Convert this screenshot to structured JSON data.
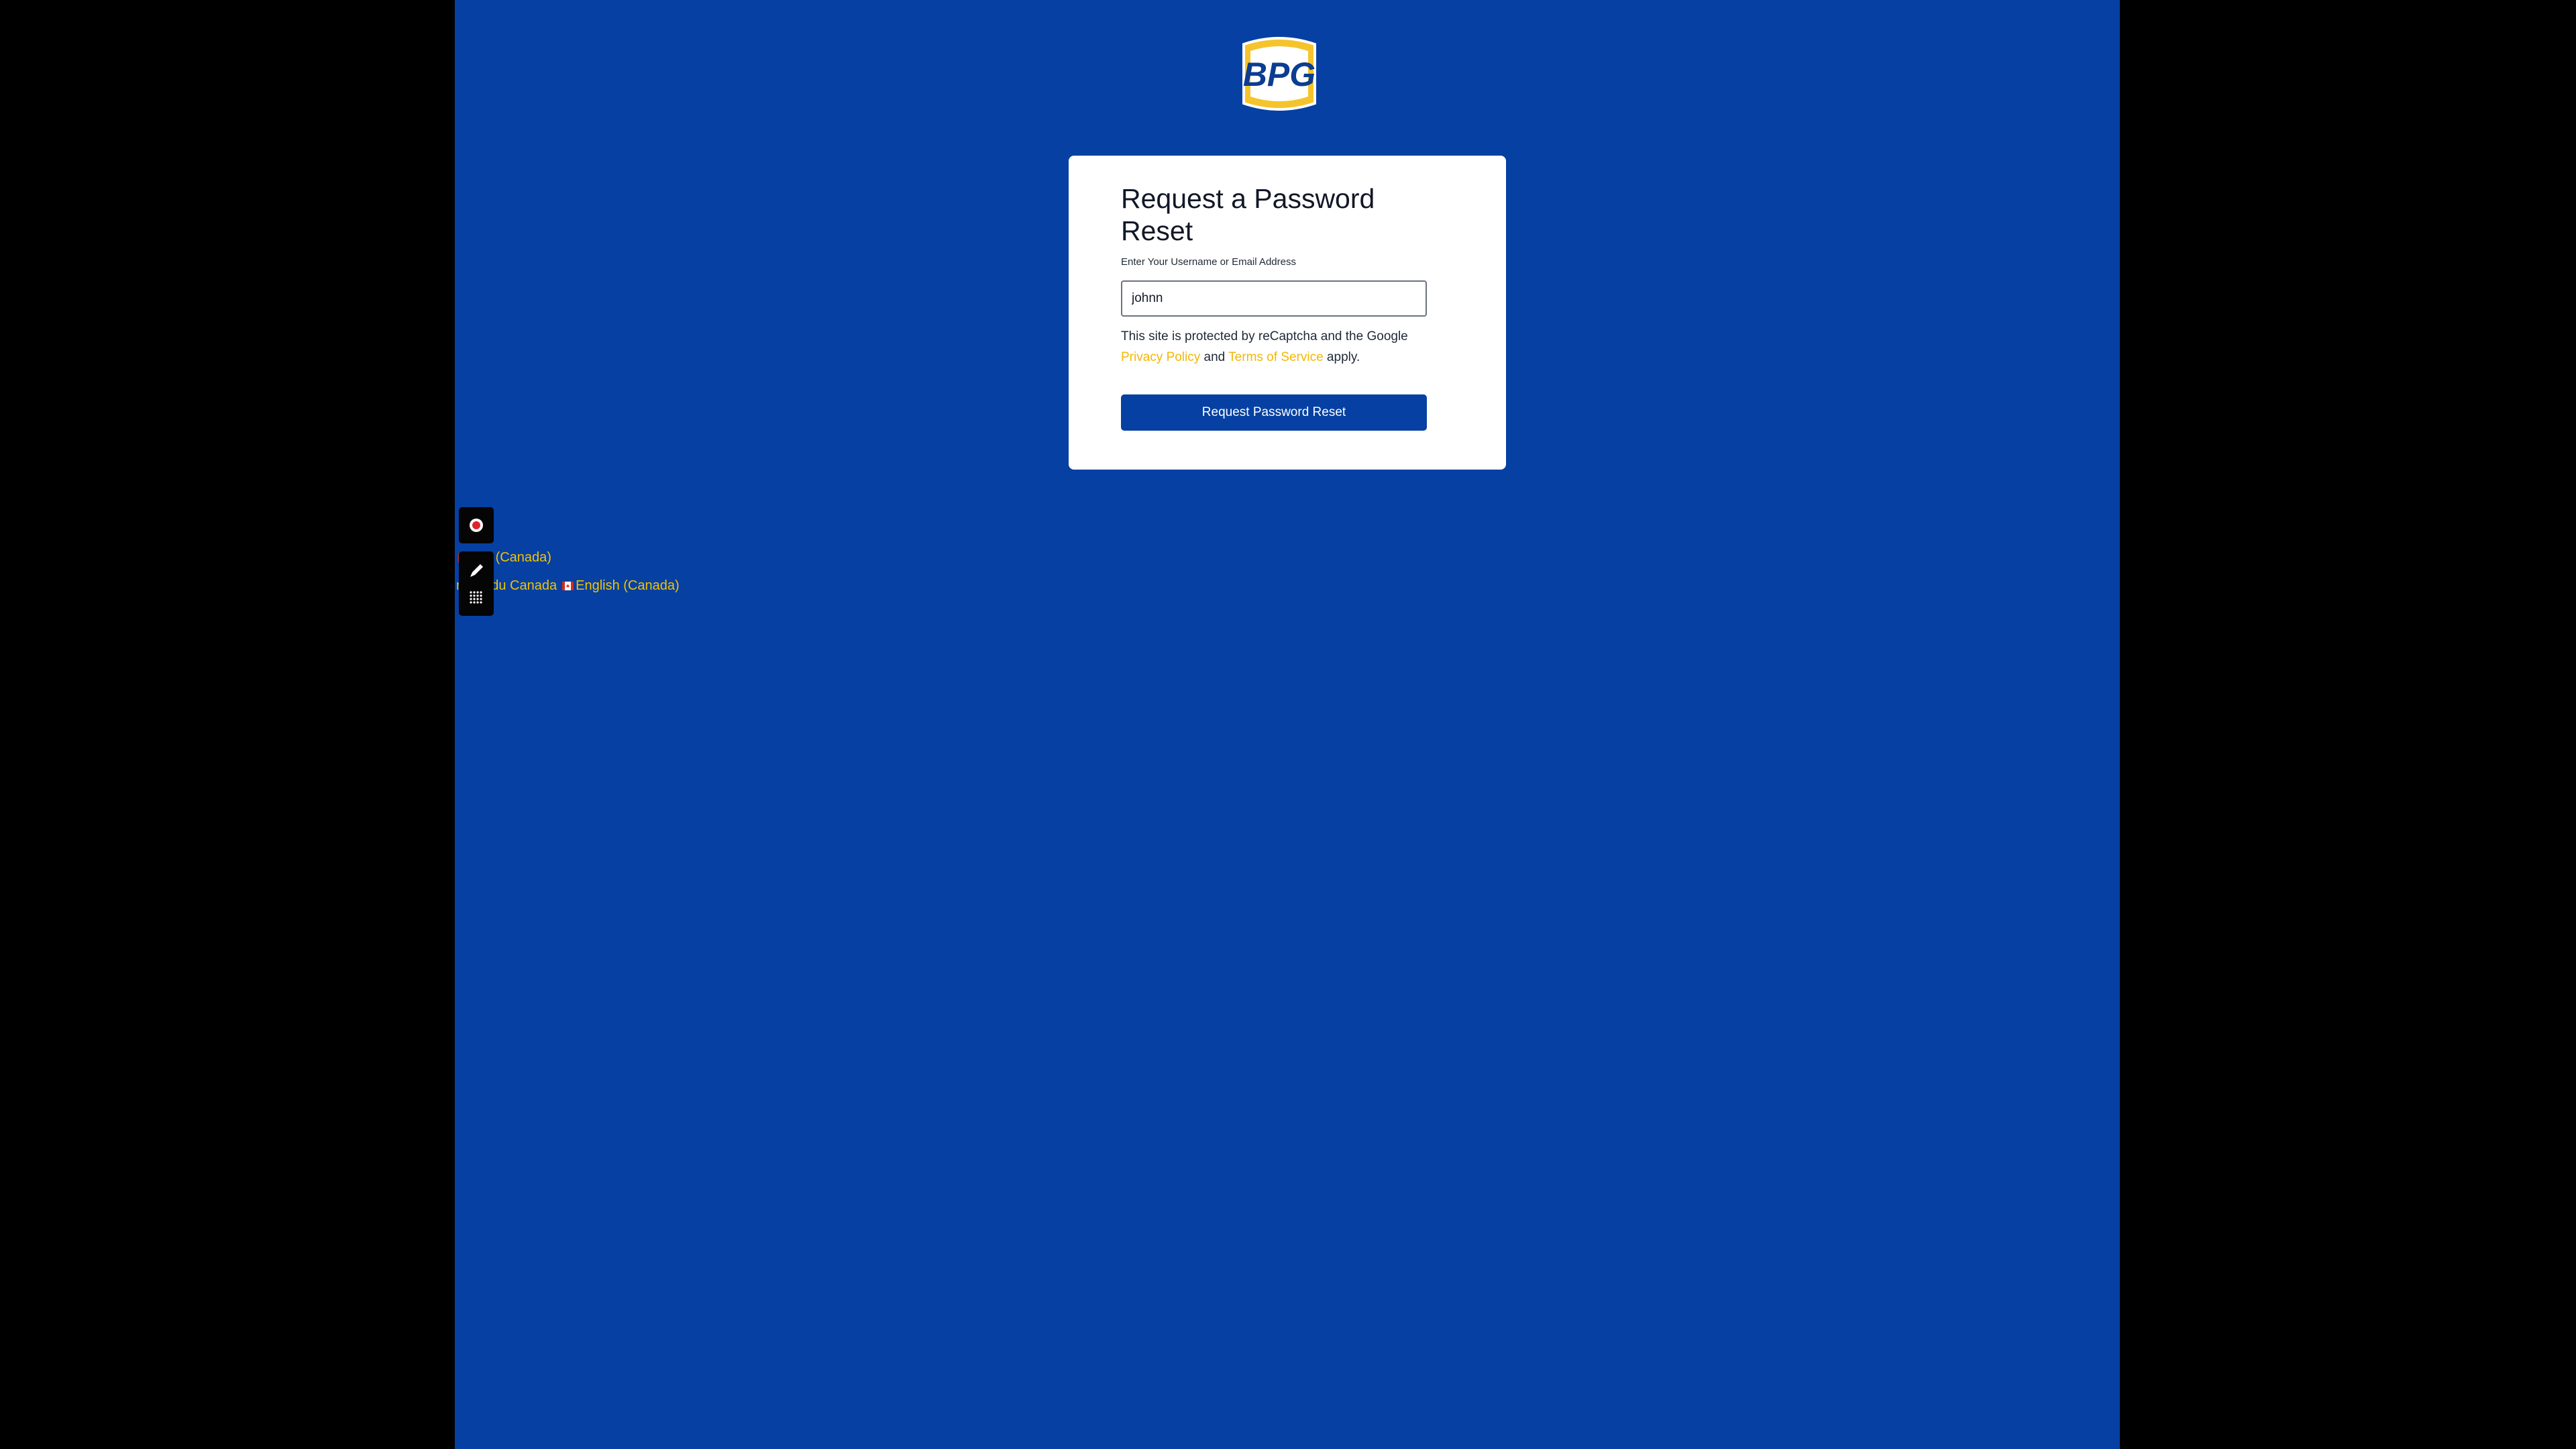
{
  "brand": {
    "logo_text": "BPG",
    "colors": {
      "background": "#0640a3",
      "accent_yellow": "#f2b705",
      "logo_yellow": "#f5c42c",
      "primary_button": "#0640a3"
    }
  },
  "reset_form": {
    "title": "Request a Password Reset",
    "field_label": "Enter Your Username or Email Address",
    "field_value": "johnn",
    "notice_prefix": "This site is protected by reCaptcha and the Google ",
    "privacy_link": "Privacy Policy",
    "notice_and": " and ",
    "terms_link": "Terms of Service",
    "notice_suffix": " apply.",
    "submit_label": "Request Password Reset"
  },
  "language_switcher": {
    "current": "lish (Canada)",
    "option_french": "nçais du Canada",
    "option_english": "English (Canada)"
  },
  "overlay_toolbar": {
    "icons": [
      "record-icon",
      "pen-icon",
      "grid-icon"
    ]
  }
}
